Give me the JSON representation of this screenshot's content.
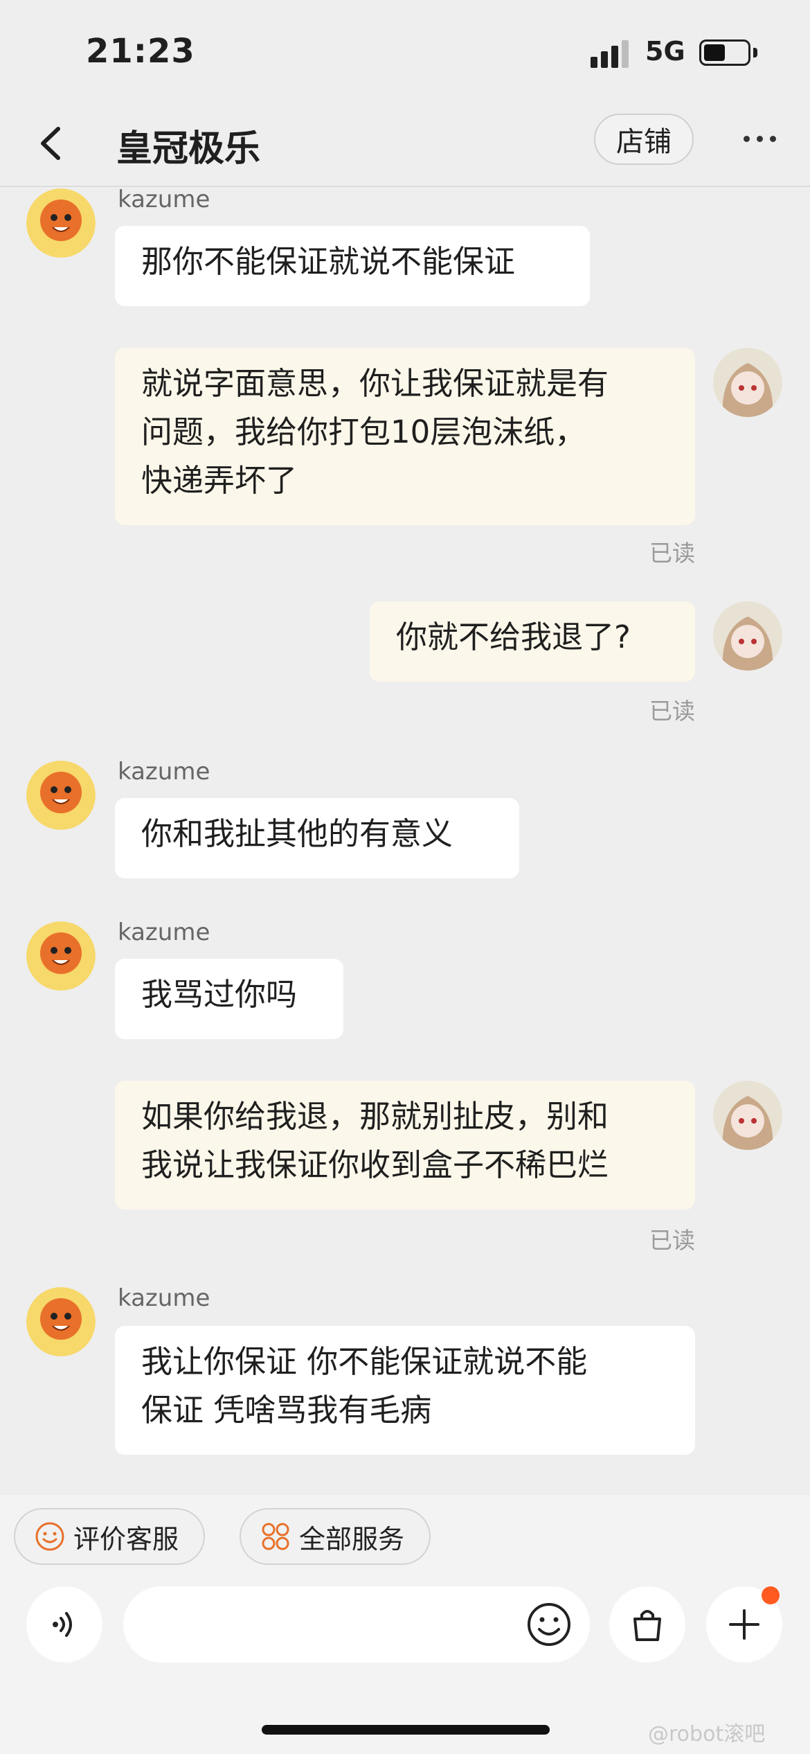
{
  "status_bar": {
    "time": "21:23",
    "network": "5G"
  },
  "header": {
    "title": "皇冠极乐",
    "shop_label": "店铺"
  },
  "messages": [
    {
      "side": "in",
      "sender": "kazume",
      "lines": [
        "那你不能保证就说不能保证"
      ]
    },
    {
      "side": "out",
      "lines": [
        "就说字面意思，你让我保证就是有",
        "问题，我给你打包10层泡沫纸，",
        "快递弄坏了"
      ],
      "status": "已读"
    },
    {
      "side": "out",
      "lines": [
        "你就不给我退了?"
      ],
      "status": "已读"
    },
    {
      "side": "in",
      "sender": "kazume",
      "lines": [
        "你和我扯其他的有意义"
      ]
    },
    {
      "side": "in",
      "sender": "kazume",
      "lines": [
        "我骂过你吗"
      ]
    },
    {
      "side": "out",
      "lines": [
        "如果你给我退，那就别扯皮，别和",
        "我说让我保证你收到盒子不稀巴烂"
      ],
      "status": "已读"
    },
    {
      "side": "in",
      "sender": "kazume",
      "lines": [
        "我让你保证 你不能保证就说不能",
        "保证 凭啥骂我有毛病"
      ]
    }
  ],
  "quick_actions": {
    "rate_label": "评价客服",
    "services_label": "全部服务"
  },
  "watermark": "@robot滚吧",
  "colors": {
    "accent": "#ff5a1f",
    "out_bubble": "#fbf7ea",
    "in_bubble": "#ffffff"
  }
}
